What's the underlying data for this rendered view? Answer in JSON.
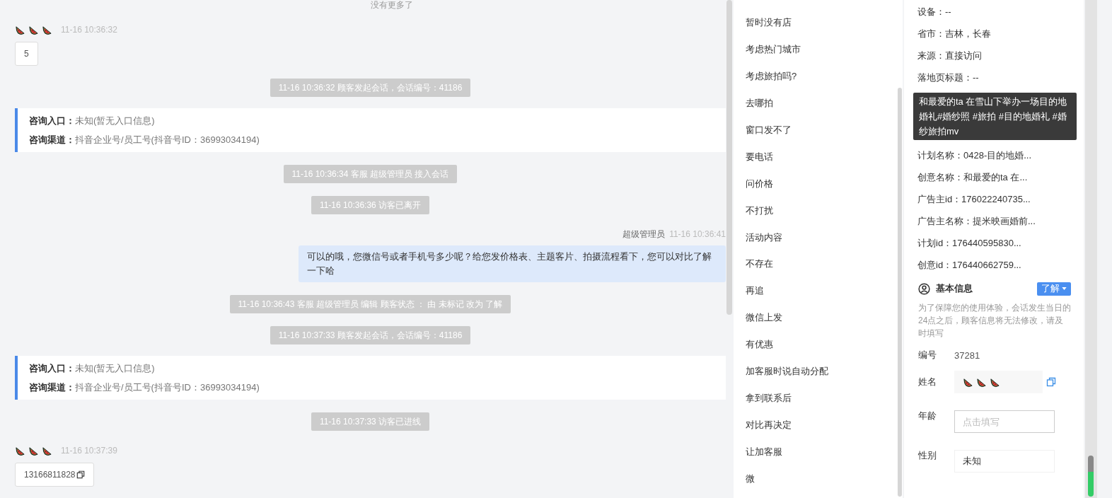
{
  "chat": {
    "top_note": "没有更多了",
    "messages": [
      {
        "kind": "visitor",
        "time": "11-16 10:36:32",
        "text": "5",
        "copyable": false
      },
      {
        "kind": "system",
        "text": "11-16 10:36:32 顾客发起会话，会话编号：41186"
      },
      {
        "kind": "info",
        "lines": [
          "**咨询入口：**未知(暂无入口信息)",
          "**咨询渠道：**抖音企业号/员工号(抖音号ID：36993034194)"
        ]
      },
      {
        "kind": "system",
        "text": "11-16 10:36:34 客服 超级管理员 接入会话"
      },
      {
        "kind": "system",
        "text": "11-16 10:36:36 访客已离开"
      },
      {
        "kind": "agent",
        "name": "超级管理员",
        "time": "11-16 10:36:41",
        "text": "可以的哦，您微信号或者手机号多少呢？给您发价格表、主题客片、拍摄流程看下，您可以对比了解一下哈"
      },
      {
        "kind": "system",
        "text": "11-16 10:36:43 客服 超级管理员 编辑 顾客状态 ： 由 未标记 改为 了解"
      },
      {
        "kind": "system",
        "text": "11-16 10:37:33 顾客发起会话，会话编号：41186"
      },
      {
        "kind": "info",
        "lines": [
          "**咨询入口：**未知(暂无入口信息)",
          "**咨询渠道：**抖音企业号/员工号(抖音号ID：36993034194)"
        ]
      },
      {
        "kind": "system",
        "text": "11-16 10:37:33 访客已进线"
      },
      {
        "kind": "visitor",
        "time": "11-16 10:37:39",
        "text": "13166811828",
        "copyable": true
      }
    ]
  },
  "quick_replies": [
    "暂时没有店",
    "考虑热门城市",
    "考虑旅拍吗?",
    "去哪拍",
    "窗口发不了",
    "要电话",
    "问价格",
    "不打扰",
    "活动内容",
    "不存在",
    "再追",
    "微信上发",
    "有优惠",
    "加客服时说自动分配",
    "拿到联系后",
    "对比再决定",
    "让加客服",
    "微"
  ],
  "visitor_info": {
    "rows": [
      {
        "kind": "row",
        "text": "设备：--"
      },
      {
        "kind": "row",
        "text": "省市：吉林，长春"
      },
      {
        "kind": "row",
        "text": "来源：直接访问"
      },
      {
        "kind": "row",
        "text": "落地页标题：--"
      },
      {
        "kind": "tooltip",
        "text": "和最爱的ta 在雪山下举办一场目的地婚礼#婚纱照 #旅拍 #目的地婚礼 #婚纱旅拍mv"
      },
      {
        "kind": "row",
        "text": "计划名称：0428-目的地婚..."
      },
      {
        "kind": "row",
        "text": "创意名称：和最爱的ta 在..."
      },
      {
        "kind": "row",
        "text": "广告主id：176022240735..."
      },
      {
        "kind": "row",
        "text": "广告主名称：提米映画婚前..."
      },
      {
        "kind": "row",
        "text": "计划id：176440595830..."
      },
      {
        "kind": "row",
        "text": "创意id：176440662759..."
      }
    ]
  },
  "basic_info": {
    "title": "基本信息",
    "status": "了解",
    "note": "为了保障您的使用体验，会话发生当日的24点之后，顾客信息将无法修改，请及时填写",
    "fields": [
      {
        "kind": "plain",
        "label": "编号",
        "value": "37281"
      },
      {
        "kind": "nickname",
        "label": "姓名"
      },
      {
        "kind": "input",
        "label": "年龄",
        "placeholder": "点击填写"
      },
      {
        "kind": "box",
        "label": "性别",
        "value": "未知"
      }
    ]
  }
}
